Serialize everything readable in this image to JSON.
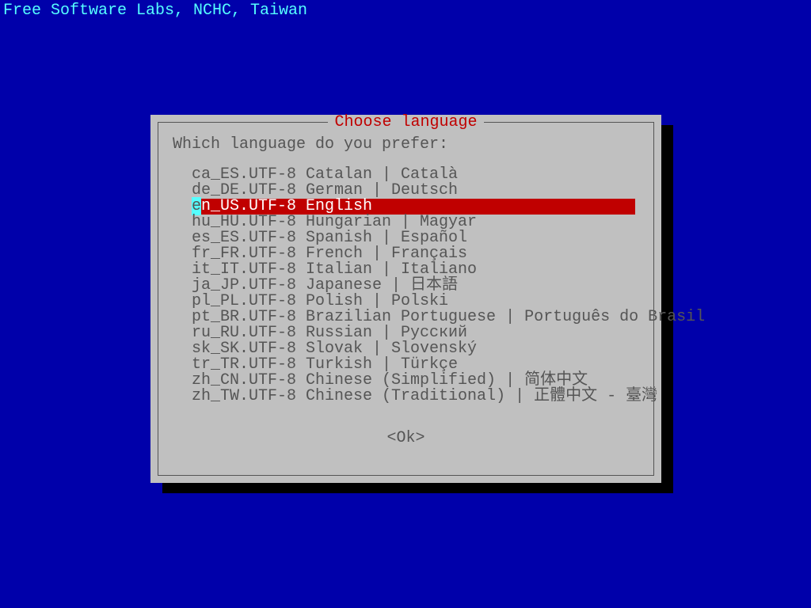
{
  "header": "Free Software Labs, NCHC, Taiwan",
  "dialog": {
    "title": "Choose language",
    "prompt": "Which language do you prefer:",
    "ok_label": "<Ok>",
    "selected_index": 2,
    "items": [
      "ca_ES.UTF-8 Catalan | Català",
      "de_DE.UTF-8 German | Deutsch",
      "en_US.UTF-8 English",
      "hu_HU.UTF-8 Hungarian | Magyar",
      "es_ES.UTF-8 Spanish | Español",
      "fr_FR.UTF-8 French | Français",
      "it_IT.UTF-8 Italian | Italiano",
      "ja_JP.UTF-8 Japanese | 日本語",
      "pl_PL.UTF-8 Polish | Polski",
      "pt_BR.UTF-8 Brazilian Portuguese | Português do Brasil",
      "ru_RU.UTF-8 Russian | Русский",
      "sk_SK.UTF-8 Slovak | Slovenský",
      "tr_TR.UTF-8 Turkish | Türkçe",
      "zh_CN.UTF-8 Chinese (Simplified) | 简体中文",
      "zh_TW.UTF-8 Chinese (Traditional) | 正體中文 - 臺灣"
    ]
  }
}
